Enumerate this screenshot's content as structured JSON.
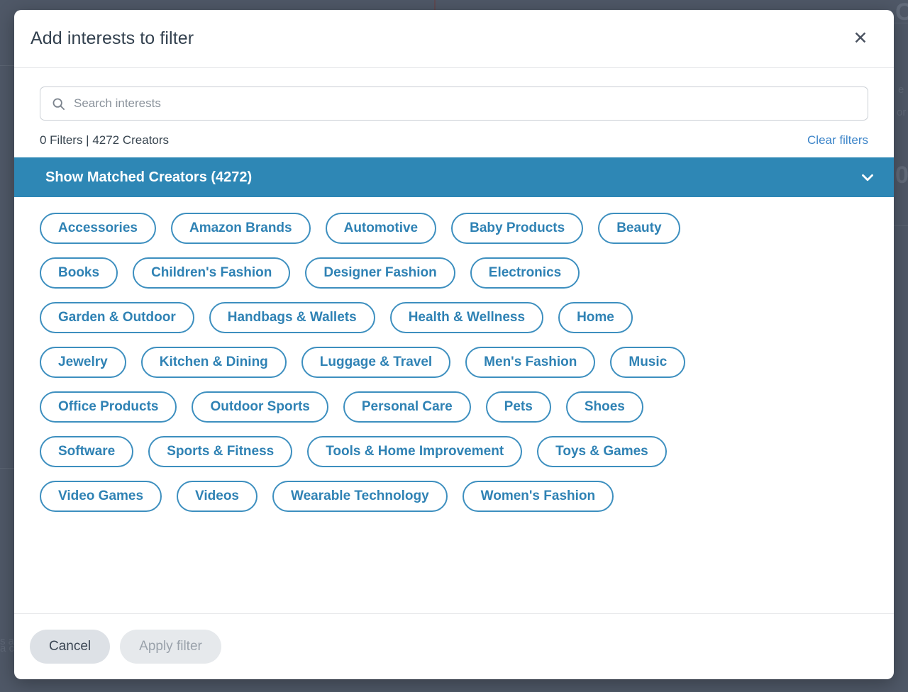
{
  "modal": {
    "title": "Add interests to filter",
    "close_icon": "close-icon",
    "search": {
      "placeholder": "Search interests",
      "value": "",
      "icon": "search-icon"
    },
    "status_text": "0 Filters | 4272 Creators",
    "filters_count": "0",
    "creators_count": "4272",
    "clear_filters_label": "Clear filters",
    "accordion": {
      "label": "Show Matched Creators (4272)",
      "chevron_icon": "chevron-down-icon",
      "background_color": "#2e87b5"
    },
    "interest_rows": [
      [
        "Accessories",
        "Amazon Brands",
        "Automotive",
        "Baby Products",
        "Beauty"
      ],
      [
        "Books",
        "Children's Fashion",
        "Designer Fashion",
        "Electronics"
      ],
      [
        "Garden & Outdoor",
        "Handbags & Wallets",
        "Health & Wellness",
        "Home"
      ],
      [
        "Jewelry",
        "Kitchen & Dining",
        "Luggage & Travel",
        "Men's Fashion",
        "Music"
      ],
      [
        "Office Products",
        "Outdoor Sports",
        "Personal Care",
        "Pets",
        "Shoes"
      ],
      [
        "Software",
        "Sports & Fitness",
        "Tools & Home Improvement",
        "Toys & Games"
      ],
      [
        "Video Games",
        "Videos",
        "Wearable Technology",
        "Women's Fashion"
      ]
    ],
    "footer": {
      "cancel_label": "Cancel",
      "apply_label": "Apply filter"
    },
    "colors": {
      "accent_blue": "#2e87b5",
      "chip_border": "#3d8fbf",
      "link_blue": "#3d85c9",
      "title_text": "#32404e",
      "overlay": "#4b5563"
    }
  },
  "background": {
    "fragments": [
      "Ca",
      "e",
      "or",
      "0",
      "s a",
      "a c"
    ]
  }
}
